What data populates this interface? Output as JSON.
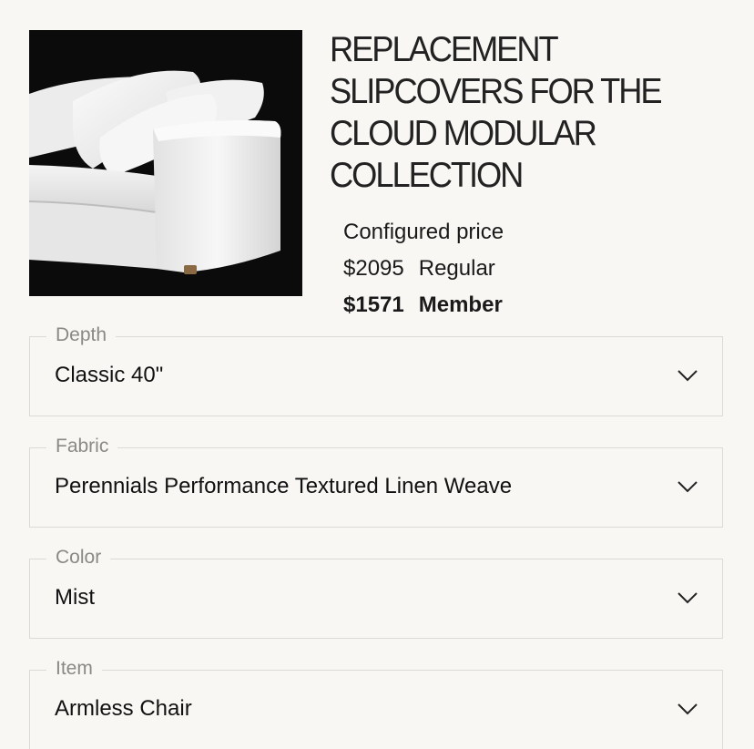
{
  "product": {
    "title_lines": [
      "REPLACEMENT",
      "SLIPCOVERS FOR THE",
      "CLOUD MODULAR",
      "COLLECTION"
    ],
    "image_icon": "sofa-photo"
  },
  "pricing": {
    "configured_label": "Configured price",
    "regular_amount": "$2095",
    "regular_label": "Regular",
    "member_amount": "$1571",
    "member_label": "Member"
  },
  "options": [
    {
      "label": "Depth",
      "value": "Classic 40\"",
      "icon": "chevron-down-icon"
    },
    {
      "label": "Fabric",
      "value": "Perennials Performance Textured Linen Weave",
      "icon": "chevron-down-icon"
    },
    {
      "label": "Color",
      "value": "Mist",
      "icon": "chevron-down-icon"
    },
    {
      "label": "Item",
      "value": "Armless Chair",
      "icon": "chevron-down-icon"
    }
  ],
  "colors": {
    "background": "#f8f7f4",
    "image_background": "#0b0b0b",
    "label_gray": "#8b8985",
    "border": "#dcdad6"
  }
}
